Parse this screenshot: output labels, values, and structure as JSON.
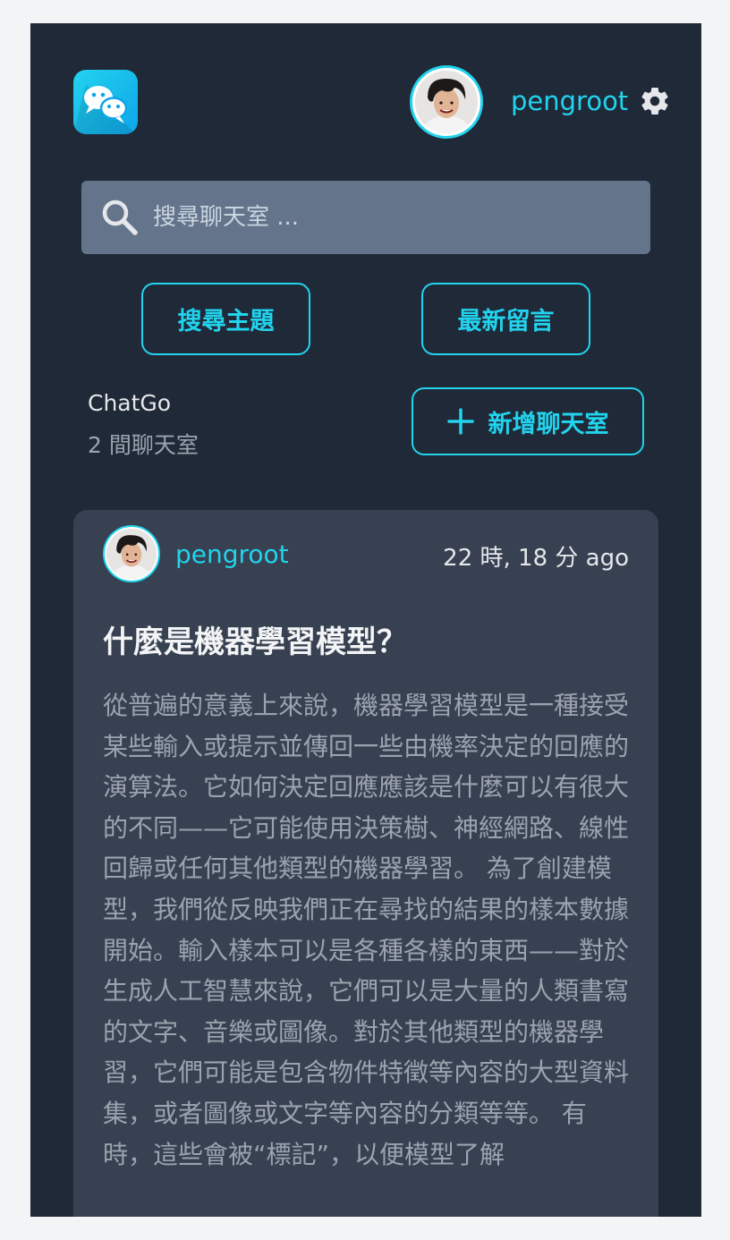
{
  "header": {
    "app_logo_icon": "chat-bubbles-icon",
    "username": "pengroot",
    "settings_icon": "gear-icon"
  },
  "search": {
    "placeholder": "搜尋聊天室 ..."
  },
  "actions": {
    "search_topic_label": "搜尋主題",
    "latest_messages_label": "最新留言",
    "new_room_label": "新增聊天室"
  },
  "site": {
    "name": "ChatGo",
    "room_count": "2 間聊天室"
  },
  "post": {
    "username": "pengroot",
    "time": "22 時, 18 分 ago",
    "title": "什麼是機器學習模型？",
    "body": "從普遍的意義上來說，機器學習模型是一種接受某些輸入或提示並傳回一些由機率決定的回應的演算法。它如何決定回應應該是什麼可以有很大的不同——它可能使用決策樹、神經網路、線性回歸或任何其他類型的機器學習。 為了創建模型，我們從反映我們正在尋找的結果的樣本數據開始。輸入樣本可以是各種各樣的東西——對於生成人工智慧來說，它們可以是大量的人類書寫的文字、音樂或圖像。對於其他類型的機器學習，它們可能是包含物件特徵等內容的大型資料集，或者圖像或文字等內容的分類等等。 有時，這些會被“標記”，以便模型了解"
  },
  "colors": {
    "background": "#1f2937",
    "card": "#374151",
    "accent": "#22d3ee",
    "search_bg": "#64748b"
  }
}
